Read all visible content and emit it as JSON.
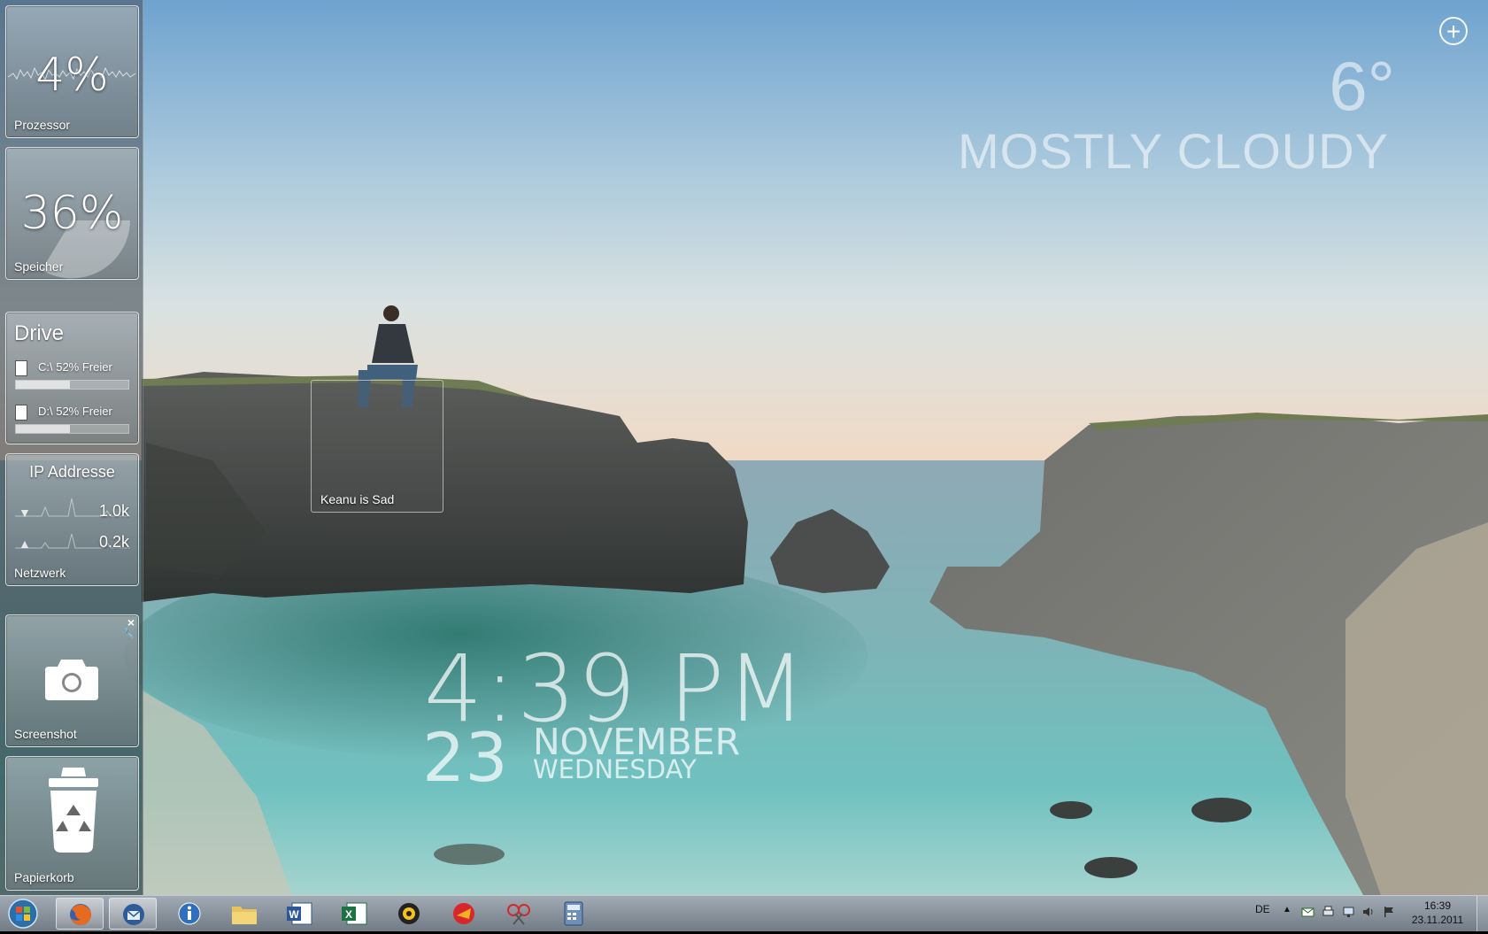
{
  "sidebar": {
    "cpu": {
      "value": "4%",
      "label": "Prozessor"
    },
    "memory": {
      "value": "36%",
      "label": "Speicher"
    },
    "drive": {
      "title": "Drive",
      "drives": [
        {
          "text": "C:\\ 52% Freier",
          "free_fraction": 0.52
        },
        {
          "text": "D:\\ 52% Freier",
          "free_fraction": 0.52
        }
      ]
    },
    "network": {
      "title": "IP Addresse",
      "down": "1.0k",
      "up": "0.2k",
      "label": "Netzwerk"
    },
    "screenshot": {
      "label": "Screenshot",
      "close": "×",
      "settings": "🔧"
    },
    "recycle": {
      "label": "Papierkorb"
    }
  },
  "photo_gadget": {
    "caption": "Keanu is Sad"
  },
  "weather": {
    "temperature": "6°",
    "condition": "MOSTLY CLOUDY"
  },
  "add_gadget": {
    "glyph": "+"
  },
  "clock": {
    "time": "4:39 PM",
    "day": "23",
    "month": "NOVEMBER",
    "weekday": "WEDNESDAY"
  },
  "taskbar": {
    "apps": [
      {
        "name": "firefox-icon",
        "active": true
      },
      {
        "name": "thunderbird-icon",
        "active": true
      },
      {
        "name": "info-icon",
        "active": false
      },
      {
        "name": "explorer-folder-icon",
        "active": false
      },
      {
        "name": "word-icon",
        "active": false
      },
      {
        "name": "excel-icon",
        "active": false
      },
      {
        "name": "media-player-icon",
        "active": false
      },
      {
        "name": "ccleaner-icon",
        "active": false
      },
      {
        "name": "snipping-tool-icon",
        "active": false
      },
      {
        "name": "calculator-icon",
        "active": false
      }
    ],
    "tray": {
      "language": "DE",
      "time": "16:39",
      "date": "23.11.2011"
    }
  }
}
